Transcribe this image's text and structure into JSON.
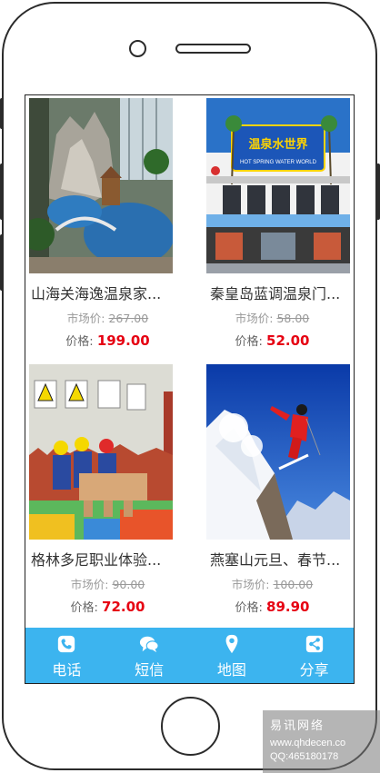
{
  "products": [
    {
      "title": "山海关海逸温泉家...",
      "market_label": "市场价:",
      "market_price": "267.00",
      "price_label": "价格:",
      "price": "199.00"
    },
    {
      "title": "秦皇岛蓝调温泉门...",
      "market_label": "市场价:",
      "market_price": "58.00",
      "price_label": "价格:",
      "price": "52.00"
    },
    {
      "title": "格林多尼职业体验...",
      "market_label": "市场价:",
      "market_price": "90.00",
      "price_label": "价格:",
      "price": "72.00"
    },
    {
      "title": "燕塞山元旦、春节...",
      "market_label": "市场价:",
      "market_price": "100.00",
      "price_label": "价格:",
      "price": "89.90"
    }
  ],
  "tabbar": {
    "items": [
      {
        "label": "电话",
        "icon": "phone-icon"
      },
      {
        "label": "短信",
        "icon": "chat-icon"
      },
      {
        "label": "地图",
        "icon": "map-pin-icon"
      },
      {
        "label": "分享",
        "icon": "share-icon"
      }
    ]
  },
  "hotspring_sign": {
    "chinese": "温泉水世界",
    "english": "HOT SPRING WATER WORLD"
  },
  "watermark": {
    "brand": "易讯网络",
    "site": "www.qhdecen.co",
    "qq": "QQ:465180178"
  },
  "colors": {
    "accent": "#3cb4ef",
    "price": "#e60012",
    "muted": "#999999"
  }
}
